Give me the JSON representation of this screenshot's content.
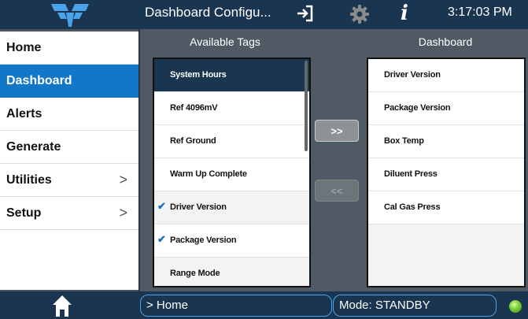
{
  "header": {
    "title": "Dashboard Configu...",
    "time": "3:17:03 PM",
    "logo_icon": "teledyne-logo-icon",
    "export_icon": "export-icon",
    "settings_icon": "gear-icon",
    "info_icon": "info-icon",
    "info_glyph": "i"
  },
  "sidebar": {
    "items": [
      {
        "label": "Home",
        "active": false,
        "chevron": false
      },
      {
        "label": "Dashboard",
        "active": true,
        "chevron": false
      },
      {
        "label": "Alerts",
        "active": false,
        "chevron": false
      },
      {
        "label": "Generate",
        "active": false,
        "chevron": false
      },
      {
        "label": "Utilities",
        "active": false,
        "chevron": true,
        "chevron_glyph": ">"
      },
      {
        "label": "Setup",
        "active": false,
        "chevron": true,
        "chevron_glyph": ">"
      }
    ]
  },
  "available": {
    "title": "Available Tags",
    "items": [
      {
        "label": "System Hours",
        "selected": true,
        "checked": false
      },
      {
        "label": "Ref 4096mV",
        "selected": false,
        "checked": false
      },
      {
        "label": "Ref Ground",
        "selected": false,
        "checked": false
      },
      {
        "label": "Warm Up Complete",
        "selected": false,
        "checked": false
      },
      {
        "label": "Driver Version",
        "selected": false,
        "checked": true
      },
      {
        "label": "Package Version",
        "selected": false,
        "checked": true
      },
      {
        "label": "Range Mode",
        "selected": false,
        "checked": false
      }
    ]
  },
  "dashboard": {
    "title": "Dashboard",
    "items": [
      "Driver Version",
      "Package Version",
      "Box Temp",
      "Diluent Press",
      "Cal Gas Press"
    ]
  },
  "buttons": {
    "add_label": ">>",
    "remove_label": "<<"
  },
  "footer": {
    "breadcrumb": "> Home",
    "mode": "Mode: STANDBY",
    "home_icon": "home-icon",
    "status_led_color": "#7fd33b"
  },
  "colors": {
    "header_bg": "#1a3550",
    "accent": "#1377c8",
    "selected_row": "#1a3550",
    "check": "#1a6fc0"
  }
}
